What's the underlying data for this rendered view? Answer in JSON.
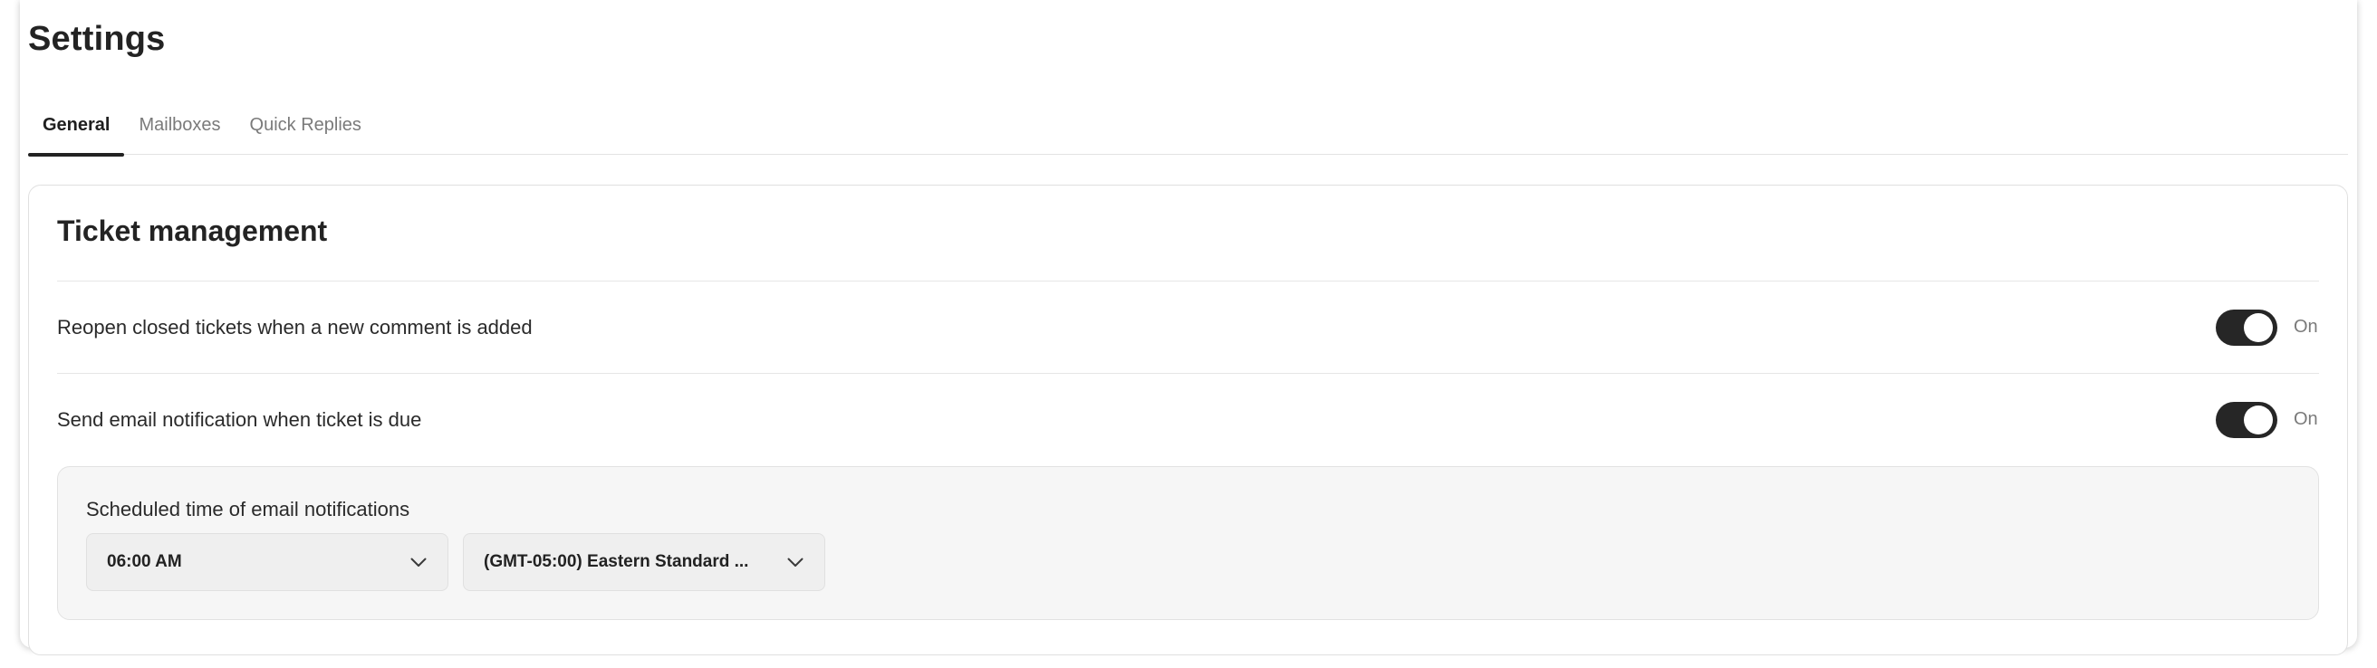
{
  "page": {
    "title": "Settings"
  },
  "tabs": [
    {
      "label": "General",
      "active": true
    },
    {
      "label": "Mailboxes",
      "active": false
    },
    {
      "label": "Quick Replies",
      "active": false
    }
  ],
  "ticket_management": {
    "title": "Ticket management",
    "settings": [
      {
        "label": "Reopen closed tickets when a new comment is added",
        "toggle_state": "On"
      },
      {
        "label": "Send email notification when ticket is due",
        "toggle_state": "On"
      }
    ],
    "schedule": {
      "label": "Scheduled time of email notifications",
      "time_value": "06:00 AM",
      "timezone_value": "(GMT-05:00) Eastern Standard ..."
    }
  },
  "icons": {
    "dropdown": "chevron-down-icon"
  },
  "colors": {
    "toggle_on": "#262626",
    "tab_active_indicator": "#222222",
    "panel_background": "#f6f6f6"
  }
}
